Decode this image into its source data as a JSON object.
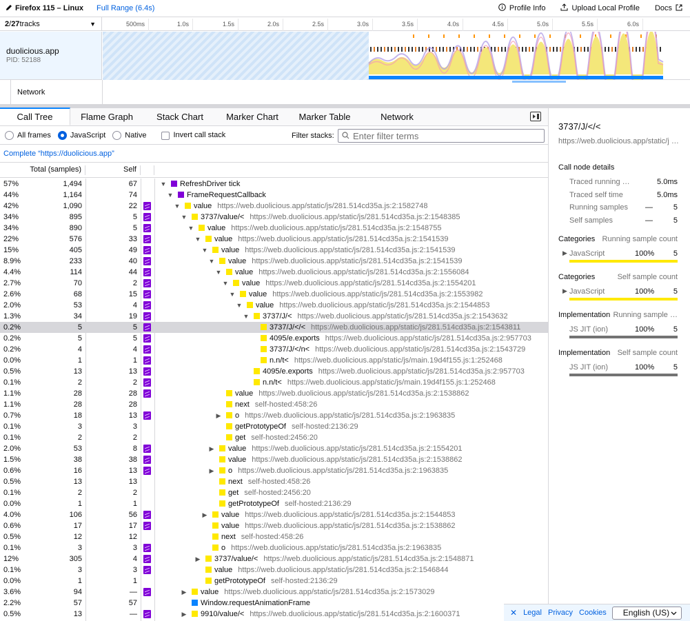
{
  "topbar": {
    "title": "Firefox 115 – Linux",
    "range": "Full Range (6.4s)",
    "profile_info": "Profile Info",
    "upload": "Upload Local Profile",
    "docs": "Docs"
  },
  "tracks": {
    "count_visible": "2",
    "count_sep": " / ",
    "count_total": "27",
    "count_suffix": " tracks",
    "ticks": [
      "500ms",
      "1.0s",
      "1.5s",
      "2.0s",
      "2.5s",
      "3.0s",
      "3.5s",
      "4.0s",
      "4.5s",
      "5.0s",
      "5.5s",
      "6.0s"
    ],
    "process_name": "duolicious.app",
    "process_pid": "PID: 52188",
    "network_label": "Network"
  },
  "tabs": [
    "Call Tree",
    "Flame Graph",
    "Stack Chart",
    "Marker Chart",
    "Marker Table",
    "Network"
  ],
  "settings": {
    "all_frames": "All frames",
    "javascript": "JavaScript",
    "native": "Native",
    "invert": "Invert call stack",
    "filter_label": "Filter stacks:",
    "filter_placeholder": "Enter filter terms"
  },
  "breadcrumb": "Complete “https://duolicious.app”",
  "tree_header": {
    "total": "Total (samples)",
    "self": "Self"
  },
  "rows": [
    {
      "pct": "57%",
      "total": "1,494",
      "self": "67",
      "js": false,
      "depth": 0,
      "tw": "open",
      "color": "#8000d7",
      "name": "RefreshDriver tick",
      "lib": ""
    },
    {
      "pct": "44%",
      "total": "1,164",
      "self": "74",
      "js": false,
      "depth": 1,
      "tw": "open",
      "color": "#8000d7",
      "name": "FrameRequestCallback",
      "lib": ""
    },
    {
      "pct": "42%",
      "total": "1,090",
      "self": "22",
      "js": true,
      "depth": 2,
      "tw": "open",
      "color": "#ffe900",
      "name": "value",
      "lib": "https://web.duolicious.app/static/js/281.514cd35a.js:2:1582748"
    },
    {
      "pct": "34%",
      "total": "895",
      "self": "5",
      "js": true,
      "depth": 3,
      "tw": "open",
      "color": "#ffe900",
      "name": "3737/value/<",
      "lib": "https://web.duolicious.app/static/js/281.514cd35a.js:2:1548385"
    },
    {
      "pct": "34%",
      "total": "890",
      "self": "5",
      "js": true,
      "depth": 4,
      "tw": "open",
      "color": "#ffe900",
      "name": "value",
      "lib": "https://web.duolicious.app/static/js/281.514cd35a.js:2:1548755"
    },
    {
      "pct": "22%",
      "total": "576",
      "self": "33",
      "js": true,
      "depth": 5,
      "tw": "open",
      "color": "#ffe900",
      "name": "value",
      "lib": "https://web.duolicious.app/static/js/281.514cd35a.js:2:1541539"
    },
    {
      "pct": "15%",
      "total": "405",
      "self": "49",
      "js": true,
      "depth": 6,
      "tw": "open",
      "color": "#ffe900",
      "name": "value",
      "lib": "https://web.duolicious.app/static/js/281.514cd35a.js:2:1541539"
    },
    {
      "pct": "8.9%",
      "total": "233",
      "self": "40",
      "js": true,
      "depth": 7,
      "tw": "open",
      "color": "#ffe900",
      "name": "value",
      "lib": "https://web.duolicious.app/static/js/281.514cd35a.js:2:1541539"
    },
    {
      "pct": "4.4%",
      "total": "114",
      "self": "44",
      "js": true,
      "depth": 8,
      "tw": "open",
      "color": "#ffe900",
      "name": "value",
      "lib": "https://web.duolicious.app/static/js/281.514cd35a.js:2:1556084"
    },
    {
      "pct": "2.7%",
      "total": "70",
      "self": "2",
      "js": true,
      "depth": 9,
      "tw": "open",
      "color": "#ffe900",
      "name": "value",
      "lib": "https://web.duolicious.app/static/js/281.514cd35a.js:2:1554201"
    },
    {
      "pct": "2.6%",
      "total": "68",
      "self": "15",
      "js": true,
      "depth": 10,
      "tw": "open",
      "color": "#ffe900",
      "name": "value",
      "lib": "https://web.duolicious.app/static/js/281.514cd35a.js:2:1553982"
    },
    {
      "pct": "2.0%",
      "total": "53",
      "self": "4",
      "js": true,
      "depth": 11,
      "tw": "open",
      "color": "#ffe900",
      "name": "value",
      "lib": "https://web.duolicious.app/static/js/281.514cd35a.js:2:1544853"
    },
    {
      "pct": "1.3%",
      "total": "34",
      "self": "19",
      "js": true,
      "depth": 12,
      "tw": "open",
      "color": "#ffe900",
      "name": "3737/J/<",
      "lib": "https://web.duolicious.app/static/js/281.514cd35a.js:2:1543632"
    },
    {
      "pct": "0.2%",
      "total": "5",
      "self": "5",
      "js": true,
      "depth": 13,
      "tw": "",
      "color": "#ffe900",
      "name": "3737/J/</<",
      "lib": "https://web.duolicious.app/static/js/281.514cd35a.js:2:1543811",
      "sel": true
    },
    {
      "pct": "0.2%",
      "total": "5",
      "self": "5",
      "js": true,
      "depth": 13,
      "tw": "",
      "color": "#ffe900",
      "name": "4095/e.exports",
      "lib": "https://web.duolicious.app/static/js/281.514cd35a.js:2:957703"
    },
    {
      "pct": "0.2%",
      "total": "4",
      "self": "4",
      "js": true,
      "depth": 13,
      "tw": "",
      "color": "#ffe900",
      "name": "3737/J/</n<",
      "lib": "https://web.duolicious.app/static/js/281.514cd35a.js:2:1543729"
    },
    {
      "pct": "0.0%",
      "total": "1",
      "self": "1",
      "js": true,
      "depth": 13,
      "tw": "",
      "color": "#ffe900",
      "name": "n.n/t<",
      "lib": "https://web.duolicious.app/static/js/main.19d4f155.js:1:252468"
    },
    {
      "pct": "0.5%",
      "total": "13",
      "self": "13",
      "js": true,
      "depth": 12,
      "tw": "",
      "color": "#ffe900",
      "name": "4095/e.exports",
      "lib": "https://web.duolicious.app/static/js/281.514cd35a.js:2:957703"
    },
    {
      "pct": "0.1%",
      "total": "2",
      "self": "2",
      "js": true,
      "depth": 12,
      "tw": "",
      "color": "#ffe900",
      "name": "n.n/t<",
      "lib": "https://web.duolicious.app/static/js/main.19d4f155.js:1:252468"
    },
    {
      "pct": "1.1%",
      "total": "28",
      "self": "28",
      "js": true,
      "depth": 8,
      "tw": "",
      "color": "#ffe900",
      "name": "value",
      "lib": "https://web.duolicious.app/static/js/281.514cd35a.js:2:1538862"
    },
    {
      "pct": "1.1%",
      "total": "28",
      "self": "28",
      "js": false,
      "depth": 8,
      "tw": "",
      "color": "#ffe900",
      "name": "next",
      "lib": "self-hosted:458:26"
    },
    {
      "pct": "0.7%",
      "total": "18",
      "self": "13",
      "js": true,
      "depth": 8,
      "tw": "closed",
      "color": "#ffe900",
      "name": "o",
      "lib": "https://web.duolicious.app/static/js/281.514cd35a.js:2:1963835"
    },
    {
      "pct": "0.1%",
      "total": "3",
      "self": "3",
      "js": false,
      "depth": 8,
      "tw": "",
      "color": "#ffe900",
      "name": "getPrototypeOf",
      "lib": "self-hosted:2136:29"
    },
    {
      "pct": "0.1%",
      "total": "2",
      "self": "2",
      "js": false,
      "depth": 8,
      "tw": "",
      "color": "#ffe900",
      "name": "get",
      "lib": "self-hosted:2456:20"
    },
    {
      "pct": "2.0%",
      "total": "53",
      "self": "8",
      "js": true,
      "depth": 7,
      "tw": "closed",
      "color": "#ffe900",
      "name": "value",
      "lib": "https://web.duolicious.app/static/js/281.514cd35a.js:2:1554201"
    },
    {
      "pct": "1.5%",
      "total": "38",
      "self": "38",
      "js": true,
      "depth": 7,
      "tw": "",
      "color": "#ffe900",
      "name": "value",
      "lib": "https://web.duolicious.app/static/js/281.514cd35a.js:2:1538862"
    },
    {
      "pct": "0.6%",
      "total": "16",
      "self": "13",
      "js": true,
      "depth": 7,
      "tw": "closed",
      "color": "#ffe900",
      "name": "o",
      "lib": "https://web.duolicious.app/static/js/281.514cd35a.js:2:1963835"
    },
    {
      "pct": "0.5%",
      "total": "13",
      "self": "13",
      "js": false,
      "depth": 7,
      "tw": "",
      "color": "#ffe900",
      "name": "next",
      "lib": "self-hosted:458:26"
    },
    {
      "pct": "0.1%",
      "total": "2",
      "self": "2",
      "js": false,
      "depth": 7,
      "tw": "",
      "color": "#ffe900",
      "name": "get",
      "lib": "self-hosted:2456:20"
    },
    {
      "pct": "0.0%",
      "total": "1",
      "self": "1",
      "js": false,
      "depth": 7,
      "tw": "",
      "color": "#ffe900",
      "name": "getPrototypeOf",
      "lib": "self-hosted:2136:29"
    },
    {
      "pct": "4.0%",
      "total": "106",
      "self": "56",
      "js": true,
      "depth": 6,
      "tw": "closed",
      "color": "#ffe900",
      "name": "value",
      "lib": "https://web.duolicious.app/static/js/281.514cd35a.js:2:1544853"
    },
    {
      "pct": "0.6%",
      "total": "17",
      "self": "17",
      "js": true,
      "depth": 6,
      "tw": "",
      "color": "#ffe900",
      "name": "value",
      "lib": "https://web.duolicious.app/static/js/281.514cd35a.js:2:1538862"
    },
    {
      "pct": "0.5%",
      "total": "12",
      "self": "12",
      "js": false,
      "depth": 6,
      "tw": "",
      "color": "#ffe900",
      "name": "next",
      "lib": "self-hosted:458:26"
    },
    {
      "pct": "0.1%",
      "total": "3",
      "self": "3",
      "js": true,
      "depth": 6,
      "tw": "",
      "color": "#ffe900",
      "name": "o",
      "lib": "https://web.duolicious.app/static/js/281.514cd35a.js:2:1963835"
    },
    {
      "pct": "12%",
      "total": "305",
      "self": "4",
      "js": true,
      "depth": 5,
      "tw": "closed",
      "color": "#ffe900",
      "name": "3737/value/<",
      "lib": "https://web.duolicious.app/static/js/281.514cd35a.js:2:1548871"
    },
    {
      "pct": "0.1%",
      "total": "3",
      "self": "3",
      "js": true,
      "depth": 5,
      "tw": "",
      "color": "#ffe900",
      "name": "value",
      "lib": "https://web.duolicious.app/static/js/281.514cd35a.js:2:1546844"
    },
    {
      "pct": "0.0%",
      "total": "1",
      "self": "1",
      "js": false,
      "depth": 5,
      "tw": "",
      "color": "#ffe900",
      "name": "getPrototypeOf",
      "lib": "self-hosted:2136:29"
    },
    {
      "pct": "3.6%",
      "total": "94",
      "self": "—",
      "js": true,
      "depth": 3,
      "tw": "closed",
      "color": "#ffe900",
      "name": "value",
      "lib": "https://web.duolicious.app/static/js/281.514cd35a.js:2:1573029"
    },
    {
      "pct": "2.2%",
      "total": "57",
      "self": "57",
      "js": false,
      "depth": 3,
      "tw": "",
      "color": "#0a84ff",
      "name": "Window.requestAnimationFrame",
      "lib": ""
    },
    {
      "pct": "0.5%",
      "total": "13",
      "self": "—",
      "js": true,
      "depth": 3,
      "tw": "closed",
      "color": "#ffe900",
      "name": "9910/value/<",
      "lib": "https://web.duolicious.app/static/js/281.514cd35a.js:2:1600371"
    }
  ],
  "sidebar": {
    "title": "3737/J/</<",
    "url": "https://web.duolicious.app/static/j …",
    "details_heading": "Call node details",
    "traced_running_label": "Traced running …",
    "traced_running_value": "5.0ms",
    "traced_self_label": "Traced self time",
    "traced_self_value": "5.0ms",
    "running_samples_label": "Running samples",
    "running_samples_dash": "—",
    "running_samples_value": "5",
    "self_samples_label": "Self samples",
    "self_samples_dash": "—",
    "self_samples_value": "5",
    "cat1_heading": "Categories",
    "cat1_sub": "Running sample count",
    "cat1_name": "JavaScript",
    "cat1_pct": "100%",
    "cat1_val": "5",
    "cat1_fill": 1.0,
    "cat2_heading": "Categories",
    "cat2_sub": "Self sample count",
    "cat2_name": "JavaScript",
    "cat2_pct": "100%",
    "cat2_val": "5",
    "cat2_fill": 1.0,
    "impl1_heading": "Implementation",
    "impl1_sub": "Running sample …",
    "impl1_name": "JS JIT (ion)",
    "impl1_pct": "100%",
    "impl1_val": "5",
    "impl1_fill": 1.0,
    "impl2_heading": "Implementation",
    "impl2_sub": "Self sample count",
    "impl2_name": "JS JIT (ion)",
    "impl2_pct": "100%",
    "impl2_val": "5",
    "impl2_fill": 1.0
  },
  "footer": {
    "legal": "Legal",
    "privacy": "Privacy",
    "cookies": "Cookies",
    "language": "English (US)"
  },
  "colors": {
    "accent": "#0060df",
    "selection_tab": "#0a84ff",
    "js_category": "#ffe900",
    "other_category": "#8000d7",
    "dom_category": "#0a84ff",
    "impl_bar": "#737373"
  }
}
